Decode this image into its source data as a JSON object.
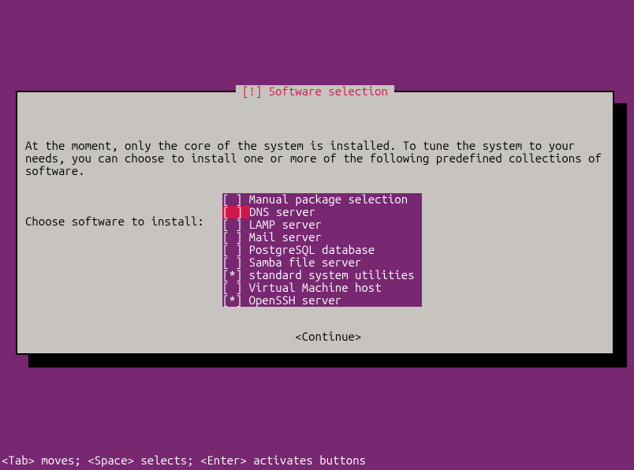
{
  "dialog": {
    "title": "[!] Software selection",
    "intro": "At the moment, only the core of the system is installed. To tune the system to your needs, you can choose to install one or more of the following predefined collections of software.",
    "prompt": "Choose software to install:",
    "continue_label": "<Continue>"
  },
  "options": [
    {
      "label": "Manual package selection",
      "checked": false,
      "focused": false
    },
    {
      "label": "DNS server",
      "checked": false,
      "focused": true
    },
    {
      "label": "LAMP server",
      "checked": false,
      "focused": false
    },
    {
      "label": "Mail server",
      "checked": false,
      "focused": false
    },
    {
      "label": "PostgreSQL database",
      "checked": false,
      "focused": false
    },
    {
      "label": "Samba file server",
      "checked": false,
      "focused": false
    },
    {
      "label": "standard system utilities",
      "checked": true,
      "focused": false
    },
    {
      "label": "Virtual Machine host",
      "checked": false,
      "focused": false
    },
    {
      "label": "OpenSSH server",
      "checked": true,
      "focused": false
    }
  ],
  "footer": {
    "hint": "<Tab> moves; <Space> selects; <Enter> activates buttons"
  },
  "width_chars": 26
}
